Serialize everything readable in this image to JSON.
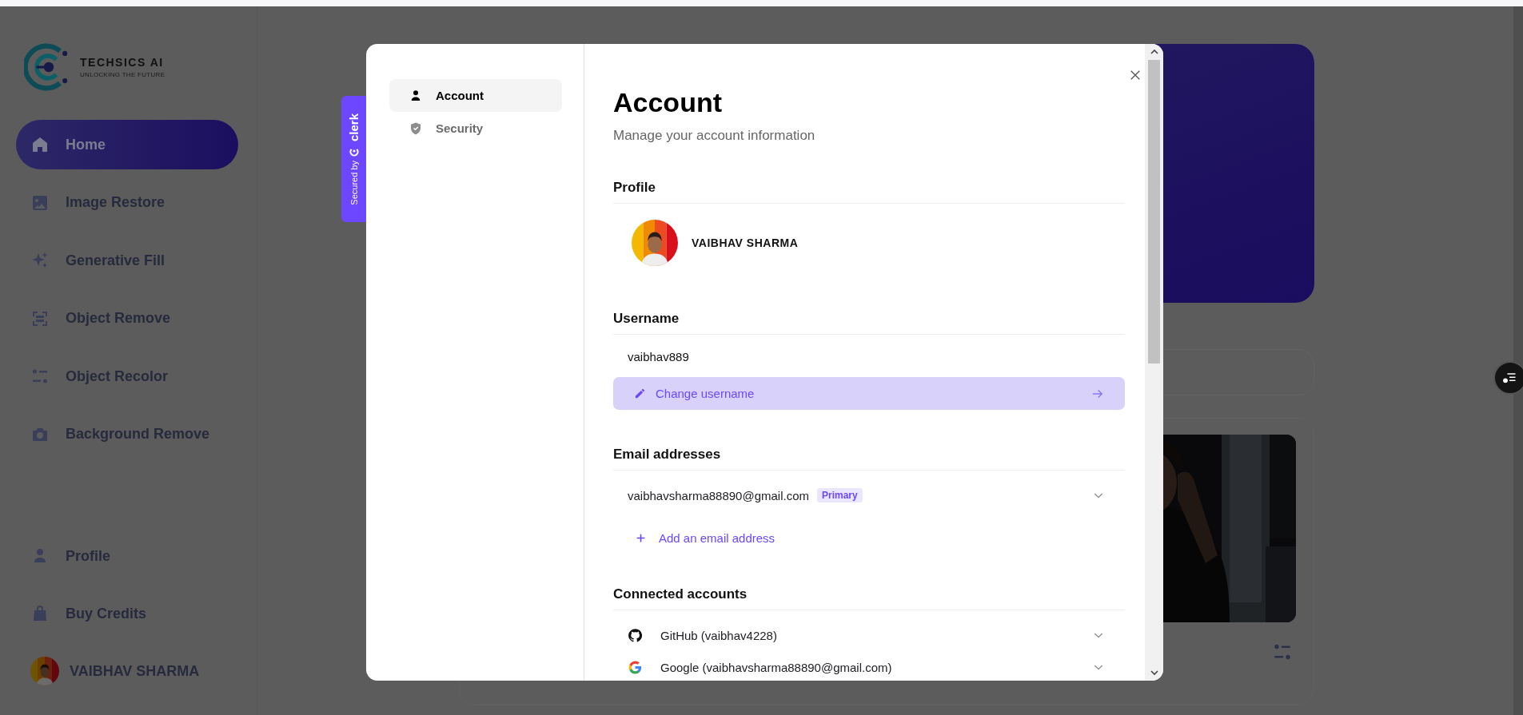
{
  "sidebar": {
    "logo": {
      "name": "TECHSICS AI",
      "tagline": "UNLOCKING THE FUTURE"
    },
    "nav": [
      {
        "label": "Home",
        "selected": true
      },
      {
        "label": "Image Restore",
        "selected": false
      },
      {
        "label": "Generative Fill",
        "selected": false
      },
      {
        "label": "Object Remove",
        "selected": false
      },
      {
        "label": "Object Recolor",
        "selected": false
      },
      {
        "label": "Background Remove",
        "selected": false
      }
    ],
    "bottom": [
      {
        "label": "Profile"
      },
      {
        "label": "Buy Credits"
      }
    ],
    "user": {
      "name": "VAIBHAV SHARMA"
    }
  },
  "secured_badge": {
    "prefix": "Secured by",
    "brand": "clerk"
  },
  "modal": {
    "nav": [
      {
        "label": "Account",
        "selected": true
      },
      {
        "label": "Security",
        "selected": false
      }
    ],
    "title": "Account",
    "subtitle": "Manage your account information",
    "profile": {
      "heading": "Profile",
      "name": "VAIBHAV SHARMA"
    },
    "username": {
      "heading": "Username",
      "value": "vaibhav889",
      "action": "Change username"
    },
    "emails": {
      "heading": "Email addresses",
      "items": [
        {
          "address": "vaibhavsharma88890@gmail.com",
          "badge": "Primary"
        }
      ],
      "add": "Add an email address"
    },
    "connected": {
      "heading": "Connected accounts",
      "items": [
        {
          "label": "GitHub (vaibhav4228)"
        },
        {
          "label": "Google (vaibhavsharma88890@gmail.com)"
        }
      ]
    }
  }
}
